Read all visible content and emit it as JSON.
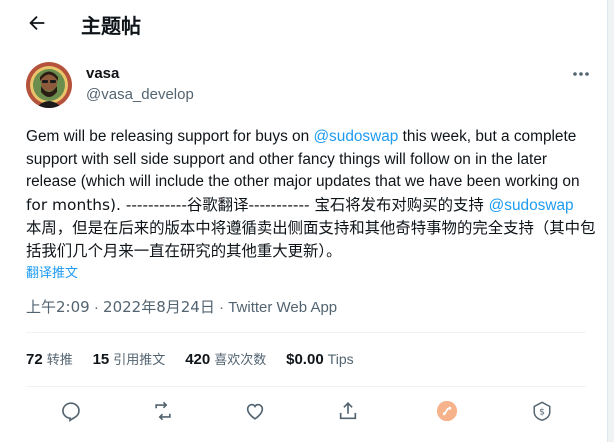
{
  "header": {
    "title": "主题帖",
    "back_icon": "arrow-left-icon"
  },
  "author": {
    "name": "vasa",
    "handle": "@vasa_develop"
  },
  "tweet": {
    "line1_a": "Gem will be releasing support for buys on ",
    "mention1": "@sudoswap",
    "line1_b": " this week, but a complete",
    "line2": "support with sell side support and other fancy things will follow on in the later",
    "line3": "release (which will include the other major updates that we have been working on",
    "line4_a": "for months). -----------谷歌翻译----------- 宝石将发布对购买的支持 ",
    "mention2": "@sudoswap",
    "line5": "本周，但是在后来的版本中将遵循卖出侧面支持和其他奇特事物的完全支持（其中包",
    "line6": "括我们几个月来一直在研究的其他重大更新）。"
  },
  "translate_label": "翻译推文",
  "meta": {
    "time": "上午2:09",
    "sep1": " · ",
    "date": "2022年8月24日",
    "sep2": " · ",
    "source": "Twitter Web App"
  },
  "stats": [
    {
      "count": "72",
      "label": "转推"
    },
    {
      "count": "15",
      "label": "引用推文"
    },
    {
      "count": "420",
      "label": "喜欢次数"
    },
    {
      "count": "$0.00",
      "label": "Tips"
    }
  ],
  "actions": [
    "reply-icon",
    "retweet-icon",
    "like-icon",
    "share-icon",
    "gem-icon",
    "tip-icon"
  ],
  "colors": {
    "link": "#1d9bf0",
    "secondary": "#536471",
    "gem": "#f4a261"
  }
}
